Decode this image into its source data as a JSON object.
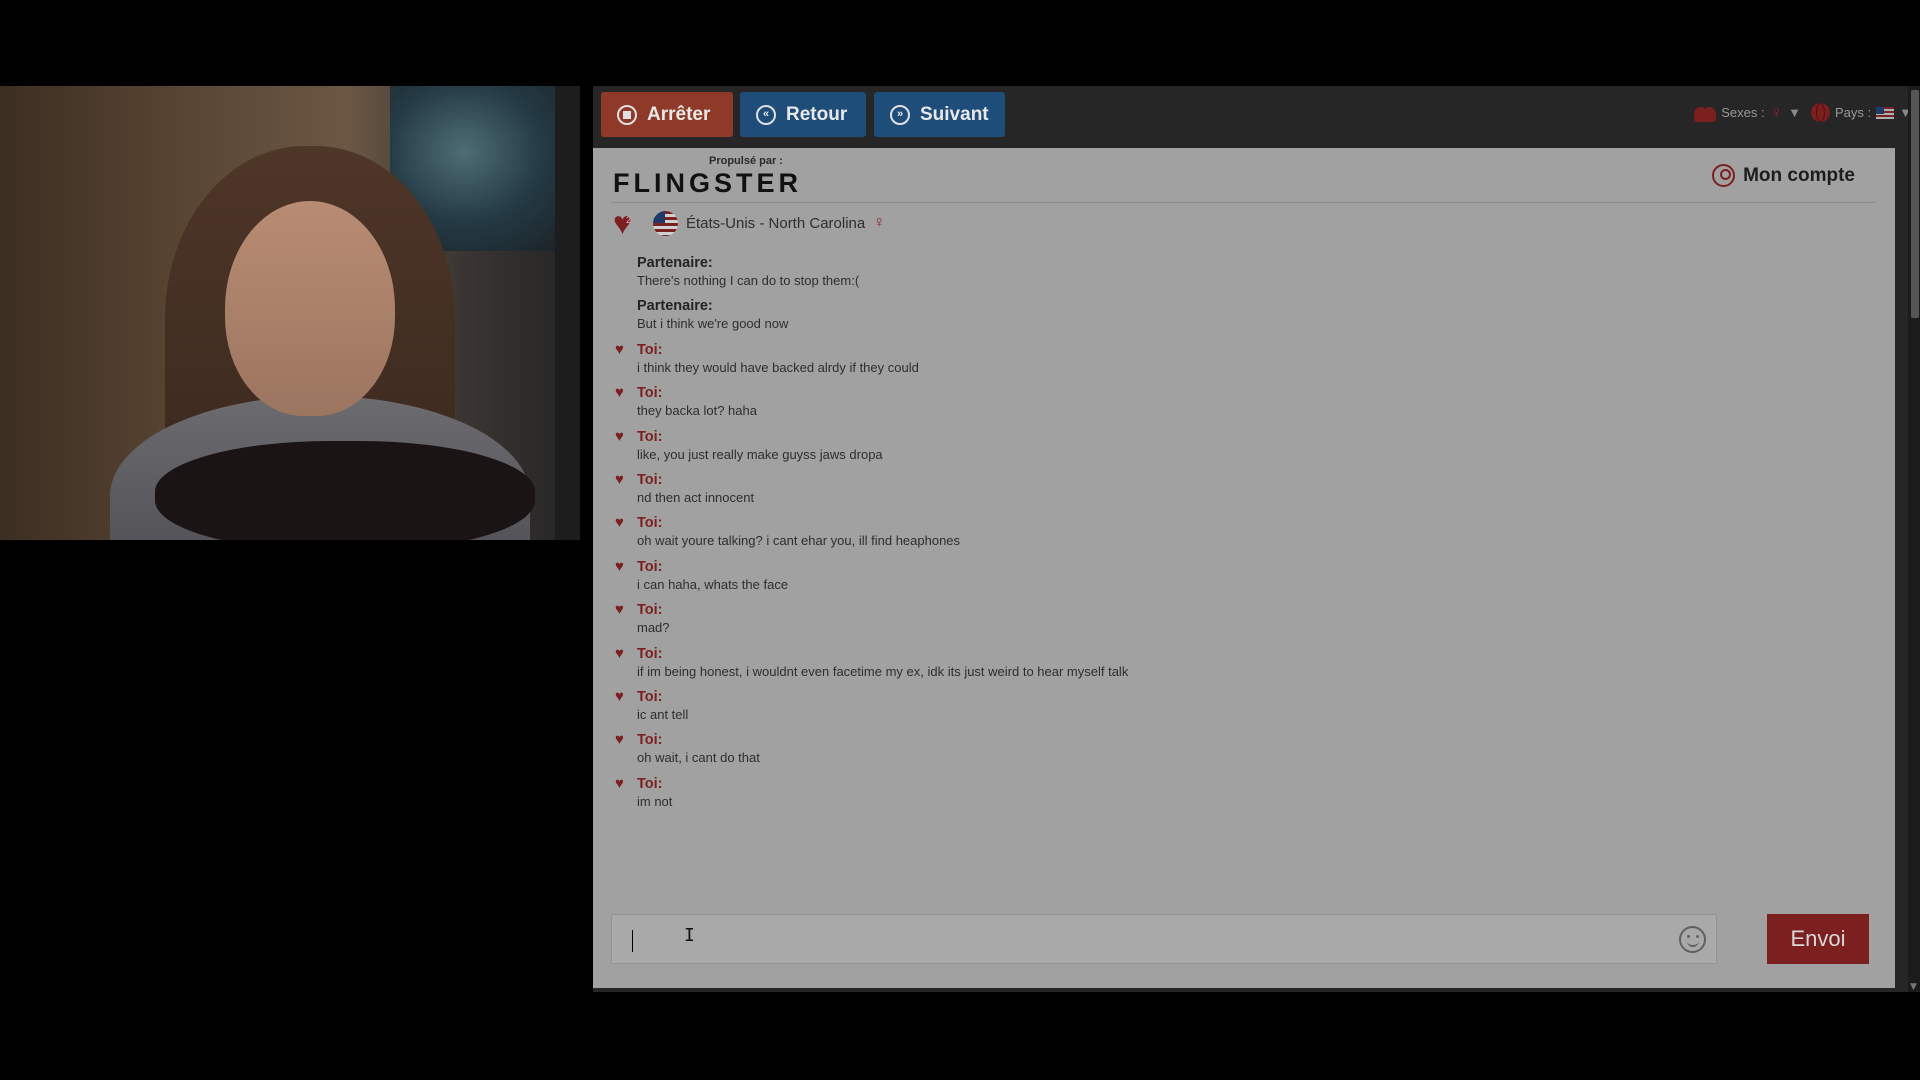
{
  "toolbar": {
    "stop_label": "Arrêter",
    "back_label": "Retour",
    "next_label": "Suivant",
    "sexes_label": "Sexes :",
    "country_label": "Pays :"
  },
  "header": {
    "powered_by": "Propulsé par :",
    "logo": "FLINGSTER",
    "account": "Mon compte"
  },
  "partner": {
    "hearts": "2",
    "location": "États-Unis - North Carolina"
  },
  "messages": [
    {
      "sender": "Partenaire:",
      "text": "There's nothing I can do to stop them:("
    },
    {
      "sender": "Partenaire:",
      "text": "But i think we're good now"
    },
    {
      "sender": "Toi:",
      "text": "i think they would have backed alrdy if they could"
    },
    {
      "sender": "Toi:",
      "text": "they backa lot? haha"
    },
    {
      "sender": "Toi:",
      "text": "like, you just really make guyss jaws dropa"
    },
    {
      "sender": "Toi:",
      "text": "nd then act innocent"
    },
    {
      "sender": "Toi:",
      "text": "oh wait youre talking? i cant ehar you, ill find heaphones"
    },
    {
      "sender": "Toi:",
      "text": "i can haha, whats the face"
    },
    {
      "sender": "Toi:",
      "text": "mad?"
    },
    {
      "sender": "Toi:",
      "text": "if im being honest, i wouldnt even facetime my ex, idk its just weird to hear myself talk"
    },
    {
      "sender": "Toi:",
      "text": "ic ant tell"
    },
    {
      "sender": "Toi:",
      "text": "oh wait, i cant do that"
    },
    {
      "sender": "Toi:",
      "text": "im not"
    }
  ],
  "composer": {
    "value": "",
    "send_label": "Envoi"
  },
  "colors": {
    "accent": "#7c1f1f",
    "nav_blue": "#1f4d7a",
    "stop_orange": "#8f3a28",
    "chat_bg": "#a1a1a1"
  }
}
